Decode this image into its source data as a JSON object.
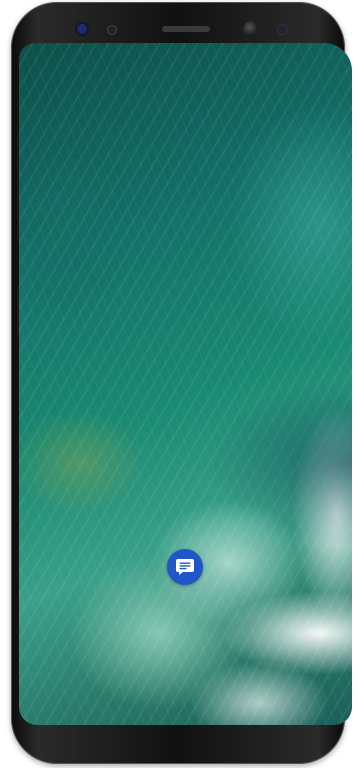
{
  "device": {
    "frame_color": "#111111"
  },
  "wallpaper": {
    "description_colors": [
      "#0d4f4a",
      "#1a8a72",
      "#3aa088"
    ]
  },
  "home_screen": {
    "app_icon": {
      "icon": "message-icon",
      "background": "#1f57c8"
    }
  }
}
